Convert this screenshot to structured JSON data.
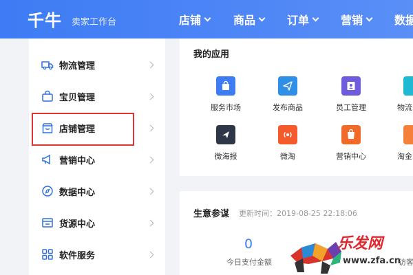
{
  "header": {
    "logo": "千牛",
    "subtitle": "卖家工作台",
    "nav": [
      "店铺",
      "商品",
      "订单",
      "营销",
      "数据"
    ]
  },
  "sidebar": {
    "items": [
      {
        "label": "物流管理",
        "icon": "truck-icon"
      },
      {
        "label": "宝贝管理",
        "icon": "bag-icon"
      },
      {
        "label": "店铺管理",
        "icon": "store-icon"
      },
      {
        "label": "营销中心",
        "icon": "megaphone-icon"
      },
      {
        "label": "数据中心",
        "icon": "compass-icon"
      },
      {
        "label": "货源中心",
        "icon": "box-icon"
      },
      {
        "label": "软件服务",
        "icon": "grid-icon"
      }
    ]
  },
  "apps": {
    "title": "我的应用",
    "items": [
      {
        "label": "服务市场",
        "icon": "market-icon",
        "color": "#3d7cf4"
      },
      {
        "label": "发布商品",
        "icon": "send-icon",
        "color": "#2f8fe6"
      },
      {
        "label": "员工管理",
        "icon": "staff-icon",
        "color": "#6f5cdc"
      },
      {
        "label": "物流",
        "icon": "logistics-icon",
        "color": "#1fb9d4"
      },
      {
        "label": "微海报",
        "icon": "poster-icon",
        "color": "#2e3647"
      },
      {
        "label": "微淘",
        "icon": "weitao-icon",
        "color": "#f45a2c"
      },
      {
        "label": "营销中心",
        "icon": "marketing-icon",
        "color": "#f26a2a"
      },
      {
        "label": "淘金",
        "icon": "taojin-icon",
        "color": "#f5803a"
      }
    ]
  },
  "business": {
    "title": "生意参谋",
    "updated": "更新时间：2019-08-25 22:18:06",
    "stat_value": "0",
    "stat_label": "今日支付金额",
    "stat_label_2": "访客数"
  },
  "watermark": {
    "text": "乐发网",
    "url": "www.zfa.cn"
  }
}
